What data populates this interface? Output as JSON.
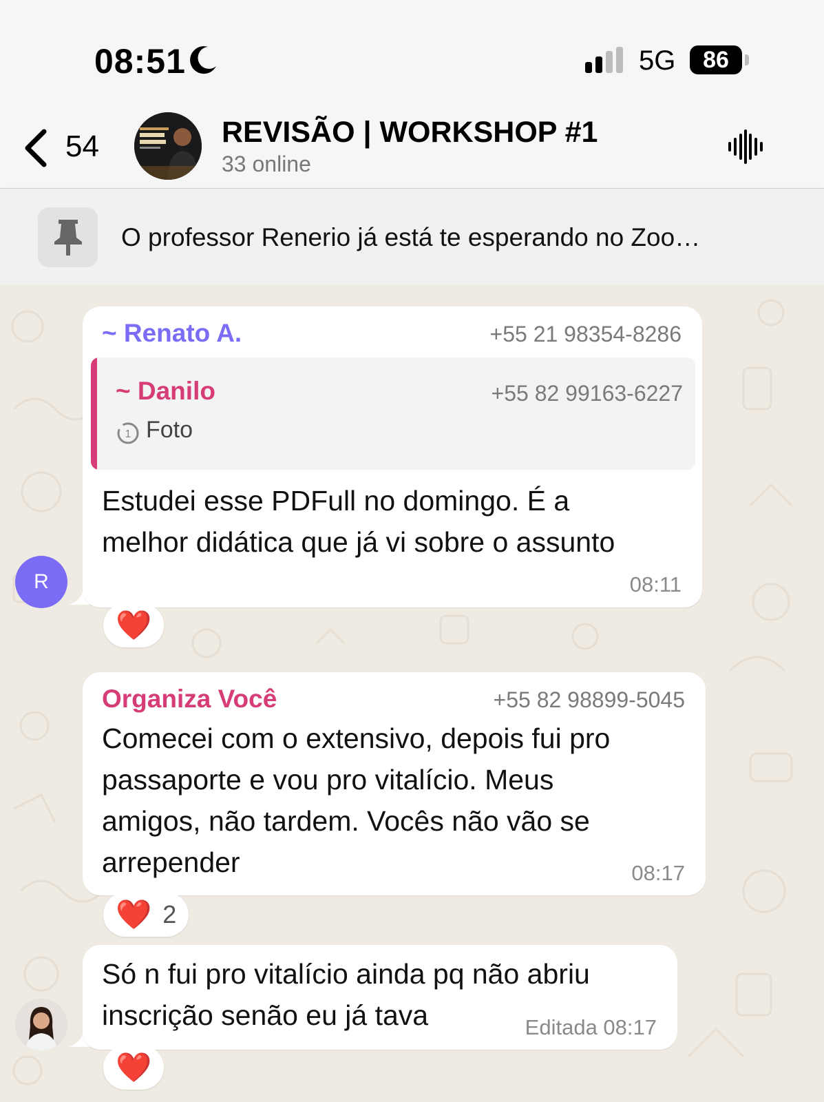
{
  "status_bar": {
    "time": "08:51",
    "network": "5G",
    "battery": "86"
  },
  "header": {
    "back_count": "54",
    "title": "REVISÃO | WORKSHOP #1",
    "subtitle": "33 online"
  },
  "pinned": {
    "text": "O professor Renerio já está te esperando no Zoo…"
  },
  "messages": [
    {
      "sender": "~ Renato A.",
      "phone": "+55 21 98354-8286",
      "quote": {
        "sender": "~ Danilo",
        "phone": "+55 82 99163-6227",
        "text": "Foto"
      },
      "text": "Estudei esse PDFull no domingo. É a\nmelhor didática que já vi sobre o assunto",
      "time": "08:11",
      "avatar_initial": "R",
      "reaction": {
        "emoji": "❤️"
      }
    },
    {
      "sender": "Organiza Você",
      "phone": "+55 82 98899-5045",
      "text": "Comecei com o extensivo, depois fui pro\npassaporte e vou pro vitalício. Meus\namigos, não tardem. Vocês não vão se\narrepender",
      "time": "08:17",
      "reaction": {
        "emoji": "❤️",
        "count": "2"
      }
    },
    {
      "text": "Só n fui pro vitalício ainda pq não abriu\ninscrição senão eu já tava",
      "time": "Editada 08:17",
      "reaction": {
        "emoji": "❤️"
      }
    }
  ],
  "colors": {
    "renato": "#7b6cf6",
    "danilo": "#d63c76",
    "organiza": "#d63c76",
    "chat_bg": "#efeae2"
  }
}
